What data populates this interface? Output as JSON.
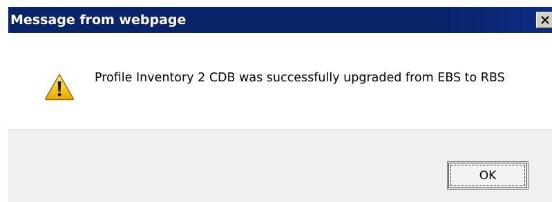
{
  "dialog": {
    "title": "Message from webpage",
    "close_icon": "close-icon",
    "message_icon": "warning-icon",
    "message": "Profile Inventory 2 CDB was successfully upgraded from EBS to RBS",
    "ok_label": "OK"
  },
  "colors": {
    "titlebar": "#0a246a",
    "title_text": "#ffffff",
    "footer": "#f0f0f0",
    "warning_fill": "#f5c518"
  }
}
